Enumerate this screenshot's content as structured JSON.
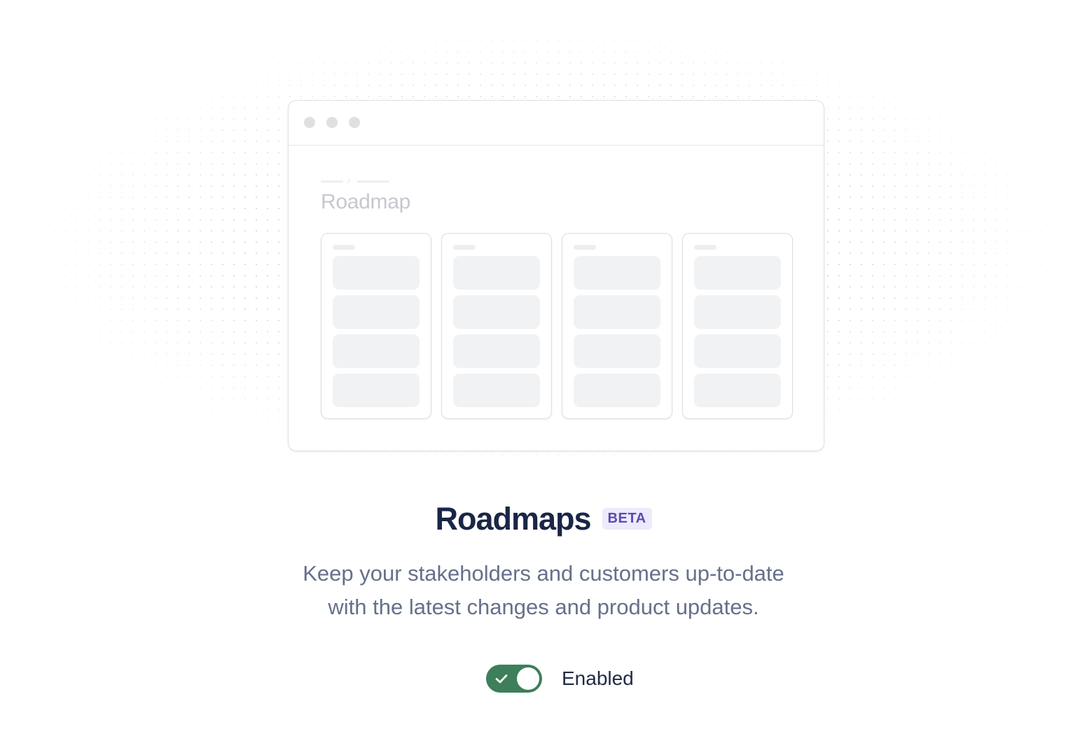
{
  "illustration": {
    "window_title": "Roadmap",
    "columns": 4,
    "cards_per_column": 4
  },
  "feature": {
    "title": "Roadmaps",
    "badge": "BETA",
    "description_line1": "Keep your stakeholders and customers up-to-date",
    "description_line2": "with the latest changes and product updates."
  },
  "toggle": {
    "state": "on",
    "label": "Enabled",
    "color": "#3d7f5a"
  },
  "icons": {
    "toggle_check": "check-icon",
    "window_controls": "window-dot-icon"
  }
}
